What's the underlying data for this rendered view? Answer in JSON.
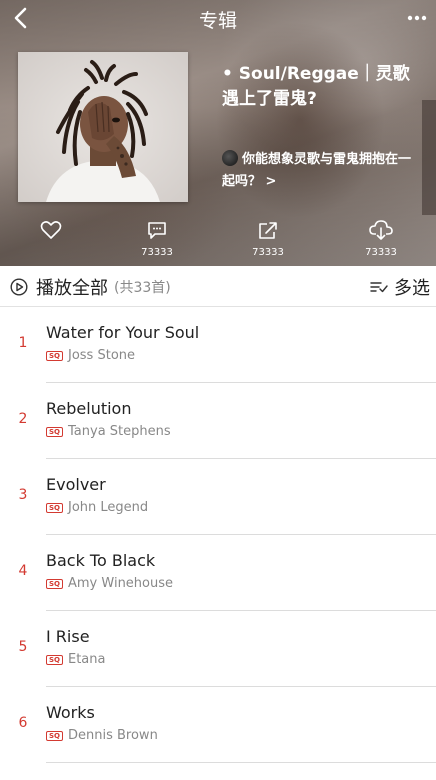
{
  "header": {
    "title": "专辑",
    "back_icon": "chevron-left-icon",
    "more_icon": "more-horizontal-icon"
  },
  "album": {
    "title": "• Soul/Reggae｜灵歌遇上了雷鬼?",
    "description": "你能想象灵歌与雷鬼拥抱在一起吗？ >"
  },
  "actions": [
    {
      "name": "like",
      "icon": "heart-icon",
      "count": ""
    },
    {
      "name": "comment",
      "icon": "comment-icon",
      "count": "73333"
    },
    {
      "name": "share",
      "icon": "share-icon",
      "count": "73333"
    },
    {
      "name": "download",
      "icon": "download-icon",
      "count": "73333"
    }
  ],
  "playbar": {
    "play_all_label": "播放全部",
    "count_label": "(共33首)",
    "multi_select_label": "多选"
  },
  "accent_color": "#d33a31",
  "quality_badge": "SQ",
  "tracks": [
    {
      "index": "1",
      "name": "Water for Your Soul",
      "artist": "Joss Stone"
    },
    {
      "index": "2",
      "name": "Rebelution",
      "artist": "Tanya Stephens"
    },
    {
      "index": "3",
      "name": "Evolver",
      "artist": "John Legend"
    },
    {
      "index": "4",
      "name": "Back To Black",
      "artist": "Amy Winehouse"
    },
    {
      "index": "5",
      "name": "I Rise",
      "artist": "Etana"
    },
    {
      "index": "6",
      "name": "Works",
      "artist": "Dennis Brown"
    }
  ]
}
